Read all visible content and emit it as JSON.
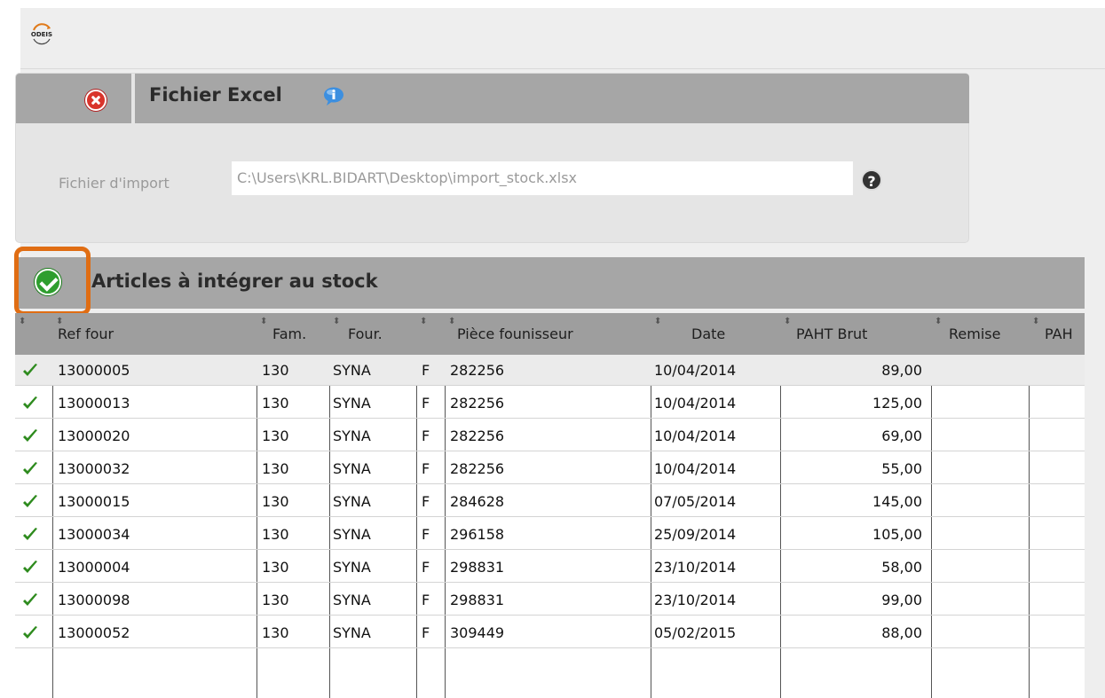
{
  "app": {
    "logo_text": "ODEIS"
  },
  "excel_panel": {
    "title": "Fichier Excel",
    "field_label": "Fichier d'import",
    "field_value": "C:\\Users\\KRL.BIDART\\Desktop\\import_stock.xlsx",
    "help_label": "?"
  },
  "articles_panel": {
    "title": "Articles à intégrer au stock"
  },
  "table": {
    "headers": [
      "Ref four",
      "Fam.",
      "Four.",
      "",
      "Pièce founisseur",
      "Date",
      "PAHT Brut",
      "Remise",
      "PAH"
    ],
    "rows": [
      [
        "13000005",
        "130",
        "SYNA",
        "F",
        "282256",
        "10/04/2014",
        "89,00",
        "",
        ""
      ],
      [
        "13000013",
        "130",
        "SYNA",
        "F",
        "282256",
        "10/04/2014",
        "125,00",
        "",
        ""
      ],
      [
        "13000020",
        "130",
        "SYNA",
        "F",
        "282256",
        "10/04/2014",
        "69,00",
        "",
        ""
      ],
      [
        "13000032",
        "130",
        "SYNA",
        "F",
        "282256",
        "10/04/2014",
        "55,00",
        "",
        ""
      ],
      [
        "13000015",
        "130",
        "SYNA",
        "F",
        "284628",
        "07/05/2014",
        "145,00",
        "",
        ""
      ],
      [
        "13000034",
        "130",
        "SYNA",
        "F",
        "296158",
        "25/09/2014",
        "105,00",
        "",
        ""
      ],
      [
        "13000004",
        "130",
        "SYNA",
        "F",
        "298831",
        "23/10/2014",
        "58,00",
        "",
        ""
      ],
      [
        "13000098",
        "130",
        "SYNA",
        "F",
        "298831",
        "23/10/2014",
        "99,00",
        "",
        ""
      ],
      [
        "13000052",
        "130",
        "SYNA",
        "F",
        "309449",
        "05/02/2015",
        "88,00",
        "",
        ""
      ]
    ]
  },
  "colors": {
    "header_gray": "#a6a6a6",
    "highlight_orange": "#e06d13",
    "check_green": "#2e9e2e",
    "close_red": "#d9342b"
  }
}
